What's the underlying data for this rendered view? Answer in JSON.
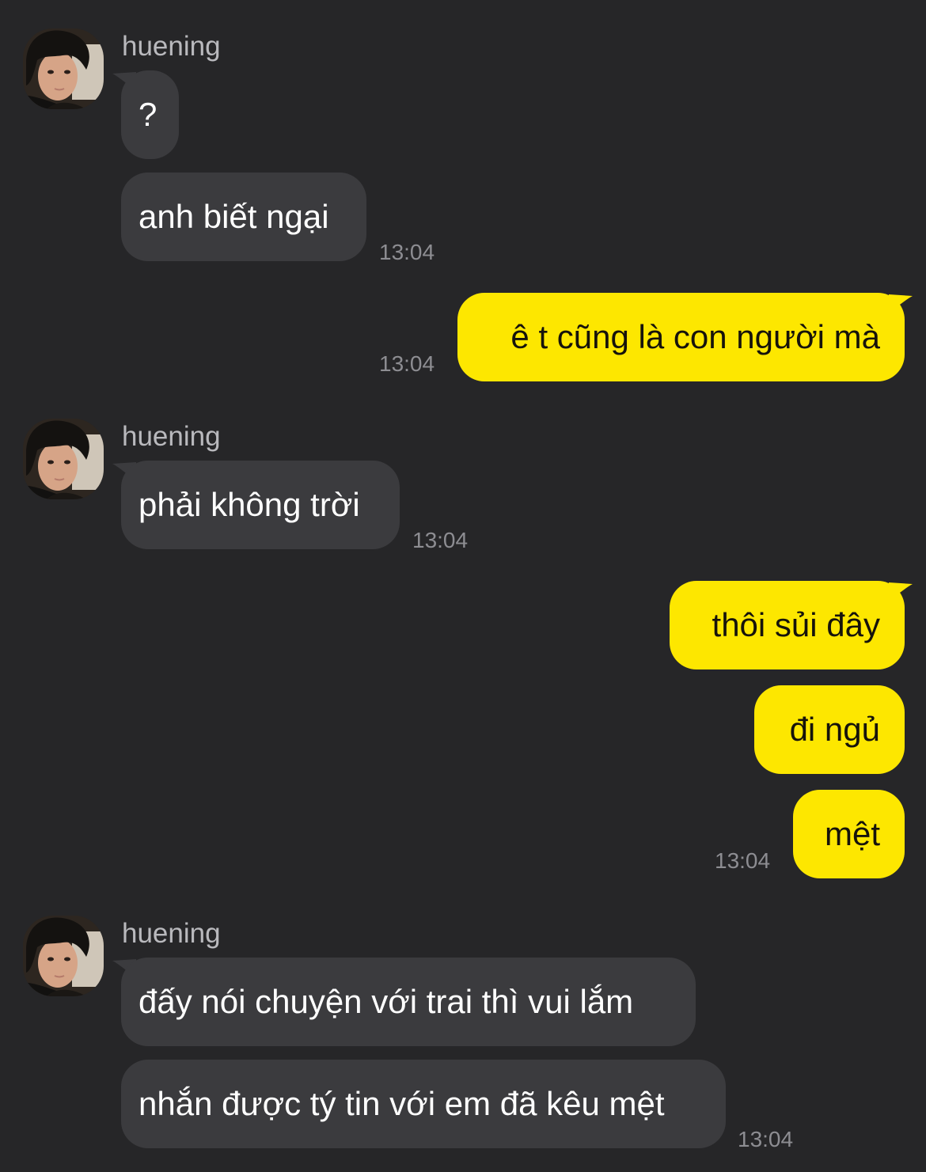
{
  "chat": {
    "groups": [
      {
        "sender": "huening",
        "avatar_icon": "profile-photo-avatar",
        "messages": [
          {
            "text": "?"
          },
          {
            "text": "anh biết ngại",
            "time": "13:04"
          }
        ]
      },
      {
        "sender": "me",
        "messages": [
          {
            "text": "ê t cũng là con người mà",
            "time": "13:04"
          }
        ]
      },
      {
        "sender": "huening",
        "avatar_icon": "profile-photo-avatar",
        "messages": [
          {
            "text": "phải không trời",
            "time": "13:04"
          }
        ]
      },
      {
        "sender": "me",
        "messages": [
          {
            "text": "thôi sủi đây"
          },
          {
            "text": "đi ngủ"
          },
          {
            "text": "mệt",
            "time": "13:04"
          }
        ]
      },
      {
        "sender": "huening",
        "avatar_icon": "profile-photo-avatar",
        "messages": [
          {
            "text": "đấy nói chuyện với trai thì vui lắm"
          },
          {
            "text": "nhắn được tý tin với em đã kêu mệt",
            "time": "13:04"
          }
        ]
      }
    ]
  },
  "colors": {
    "background": "#262628",
    "incoming_bubble": "#3b3b3e",
    "outgoing_bubble": "#fde700",
    "timestamp": "#8d8d92",
    "sender_name": "#b9b9bd"
  }
}
